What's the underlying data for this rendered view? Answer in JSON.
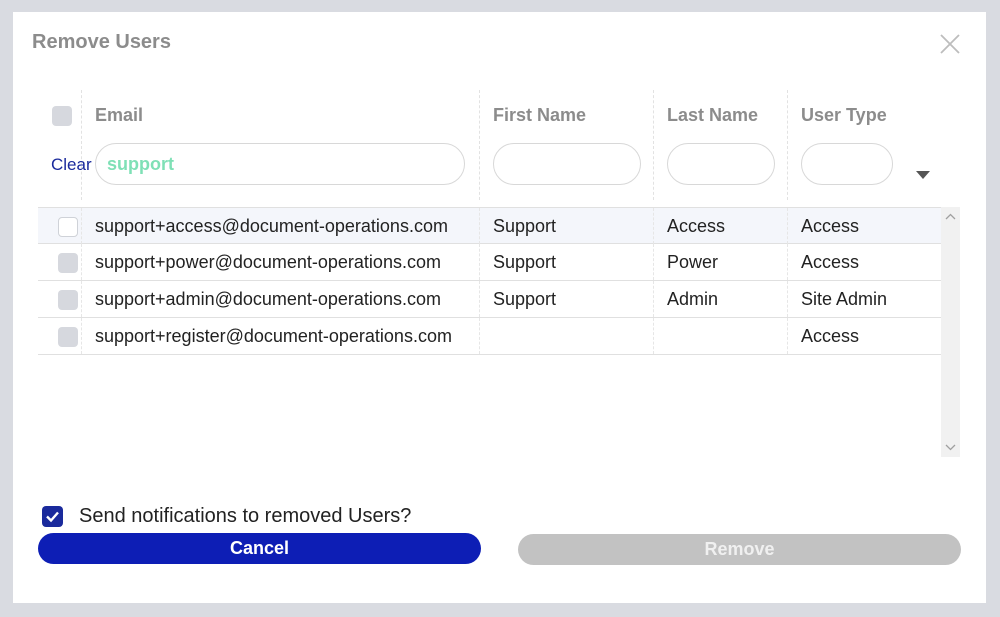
{
  "dialog": {
    "title": "Remove Users",
    "close_icon": "close-icon"
  },
  "columns": {
    "email": "Email",
    "first_name": "First Name",
    "last_name": "Last Name",
    "user_type": "User Type"
  },
  "filters": {
    "clear_label": "Clear",
    "email_value": "support",
    "first_name_value": "",
    "last_name_value": "",
    "user_type_value": ""
  },
  "rows": [
    {
      "email": "support+access@document-operations.com",
      "first_name": "Support",
      "last_name": "Access",
      "user_type": "Access"
    },
    {
      "email": "support+power@document-operations.com",
      "first_name": "Support",
      "last_name": "Power",
      "user_type": "Access"
    },
    {
      "email": "support+admin@document-operations.com",
      "first_name": "Support",
      "last_name": "Admin",
      "user_type": "Site Admin"
    },
    {
      "email": "support+register@document-operations.com",
      "first_name": "",
      "last_name": "",
      "user_type": "Access"
    }
  ],
  "footer": {
    "notify_label": "Send notifications to removed Users?",
    "notify_checked": true,
    "cancel_label": "Cancel",
    "remove_label": "Remove"
  },
  "colors": {
    "accent": "#0d1eb5",
    "filter_text": "#7fe0b6",
    "disabled": "#c2c2c2"
  }
}
